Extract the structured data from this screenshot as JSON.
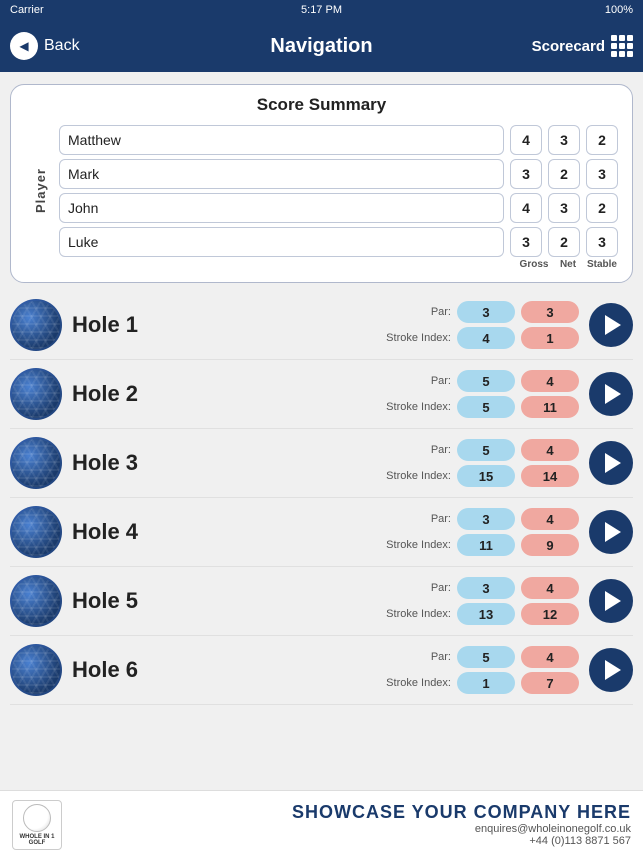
{
  "statusBar": {
    "carrier": "Carrier",
    "time": "5:17 PM",
    "battery": "100%"
  },
  "navBar": {
    "backLabel": "Back",
    "title": "Navigation",
    "scorecardLabel": "Scorecard"
  },
  "scoreSummary": {
    "title": "Score Summary",
    "playerLabel": "Player",
    "columns": [
      "Gross",
      "Net",
      "Stable"
    ],
    "players": [
      {
        "name": "Matthew",
        "gross": 4,
        "net": 3,
        "stable": 2
      },
      {
        "name": "Mark",
        "gross": 3,
        "net": 2,
        "stable": 3
      },
      {
        "name": "John",
        "gross": 4,
        "net": 3,
        "stable": 2
      },
      {
        "name": "Luke",
        "gross": 3,
        "net": 2,
        "stable": 3
      }
    ]
  },
  "holes": [
    {
      "label": "Hole 1",
      "par": 3,
      "strokeIndex": 4,
      "parScore": 3,
      "siScore": 1
    },
    {
      "label": "Hole 2",
      "par": 5,
      "strokeIndex": 5,
      "parScore": 4,
      "siScore": 11
    },
    {
      "label": "Hole 3",
      "par": 5,
      "strokeIndex": 15,
      "parScore": 4,
      "siScore": 14
    },
    {
      "label": "Hole 4",
      "par": 3,
      "strokeIndex": 11,
      "parScore": 4,
      "siScore": 9
    },
    {
      "label": "Hole 5",
      "par": 3,
      "strokeIndex": 13,
      "parScore": 4,
      "siScore": 12
    },
    {
      "label": "Hole 6",
      "par": 5,
      "strokeIndex": 1,
      "parScore": 4,
      "siScore": 7
    }
  ],
  "footer": {
    "logoText": "WHOLE IN 1 GOLF",
    "mainText": "SHOWCASE YOUR COMPANY HERE",
    "email": "enquires@wholeinonegolf.co.uk",
    "phone": "+44 (0)113 8871 567"
  }
}
